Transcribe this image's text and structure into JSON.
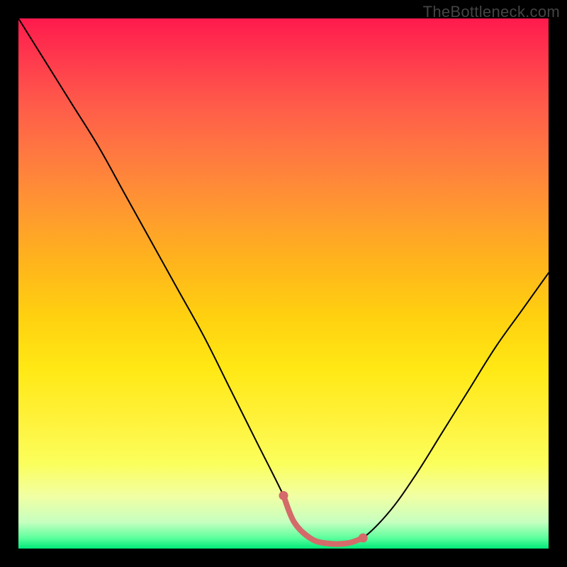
{
  "watermark": "TheBottleneck.com",
  "colors": {
    "background": "#000000",
    "gradient_top": "#ff1a4d",
    "gradient_mid": "#ffe814",
    "gradient_bottom": "#00e87a",
    "curve": "#000000",
    "highlight": "#d46a6a"
  },
  "chart_data": {
    "type": "line",
    "title": "",
    "xlabel": "",
    "ylabel": "",
    "xlim": [
      0,
      100
    ],
    "ylim": [
      0,
      100
    ],
    "grid": false,
    "legend": false,
    "annotations": [
      "TheBottleneck.com"
    ],
    "series": [
      {
        "name": "bottleneck-curve",
        "x": [
          0,
          5,
          10,
          15,
          20,
          25,
          30,
          35,
          40,
          45,
          50,
          52,
          55,
          58,
          62,
          65,
          70,
          75,
          80,
          85,
          90,
          95,
          100
        ],
        "y": [
          100,
          92,
          84,
          76,
          67,
          58,
          49,
          40,
          30,
          20,
          10,
          5,
          2,
          1,
          1,
          2,
          7,
          14,
          22,
          30,
          38,
          45,
          52
        ]
      },
      {
        "name": "optimal-zone-highlight",
        "x": [
          50,
          52,
          55,
          58,
          62,
          65
        ],
        "y": [
          10,
          5,
          2,
          1,
          1,
          2
        ]
      }
    ]
  }
}
